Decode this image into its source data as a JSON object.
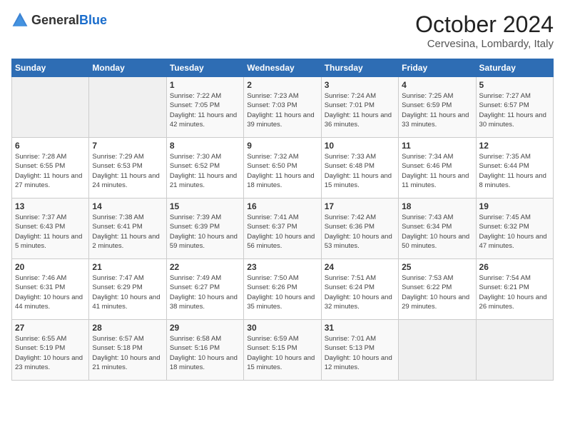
{
  "header": {
    "logo_general": "General",
    "logo_blue": "Blue",
    "month": "October 2024",
    "location": "Cervesina, Lombardy, Italy"
  },
  "days_of_week": [
    "Sunday",
    "Monday",
    "Tuesday",
    "Wednesday",
    "Thursday",
    "Friday",
    "Saturday"
  ],
  "weeks": [
    [
      {
        "day": "",
        "empty": true
      },
      {
        "day": "",
        "empty": true
      },
      {
        "day": "1",
        "sunrise": "Sunrise: 7:22 AM",
        "sunset": "Sunset: 7:05 PM",
        "daylight": "Daylight: 11 hours and 42 minutes."
      },
      {
        "day": "2",
        "sunrise": "Sunrise: 7:23 AM",
        "sunset": "Sunset: 7:03 PM",
        "daylight": "Daylight: 11 hours and 39 minutes."
      },
      {
        "day": "3",
        "sunrise": "Sunrise: 7:24 AM",
        "sunset": "Sunset: 7:01 PM",
        "daylight": "Daylight: 11 hours and 36 minutes."
      },
      {
        "day": "4",
        "sunrise": "Sunrise: 7:25 AM",
        "sunset": "Sunset: 6:59 PM",
        "daylight": "Daylight: 11 hours and 33 minutes."
      },
      {
        "day": "5",
        "sunrise": "Sunrise: 7:27 AM",
        "sunset": "Sunset: 6:57 PM",
        "daylight": "Daylight: 11 hours and 30 minutes."
      }
    ],
    [
      {
        "day": "6",
        "sunrise": "Sunrise: 7:28 AM",
        "sunset": "Sunset: 6:55 PM",
        "daylight": "Daylight: 11 hours and 27 minutes."
      },
      {
        "day": "7",
        "sunrise": "Sunrise: 7:29 AM",
        "sunset": "Sunset: 6:53 PM",
        "daylight": "Daylight: 11 hours and 24 minutes."
      },
      {
        "day": "8",
        "sunrise": "Sunrise: 7:30 AM",
        "sunset": "Sunset: 6:52 PM",
        "daylight": "Daylight: 11 hours and 21 minutes."
      },
      {
        "day": "9",
        "sunrise": "Sunrise: 7:32 AM",
        "sunset": "Sunset: 6:50 PM",
        "daylight": "Daylight: 11 hours and 18 minutes."
      },
      {
        "day": "10",
        "sunrise": "Sunrise: 7:33 AM",
        "sunset": "Sunset: 6:48 PM",
        "daylight": "Daylight: 11 hours and 15 minutes."
      },
      {
        "day": "11",
        "sunrise": "Sunrise: 7:34 AM",
        "sunset": "Sunset: 6:46 PM",
        "daylight": "Daylight: 11 hours and 11 minutes."
      },
      {
        "day": "12",
        "sunrise": "Sunrise: 7:35 AM",
        "sunset": "Sunset: 6:44 PM",
        "daylight": "Daylight: 11 hours and 8 minutes."
      }
    ],
    [
      {
        "day": "13",
        "sunrise": "Sunrise: 7:37 AM",
        "sunset": "Sunset: 6:43 PM",
        "daylight": "Daylight: 11 hours and 5 minutes."
      },
      {
        "day": "14",
        "sunrise": "Sunrise: 7:38 AM",
        "sunset": "Sunset: 6:41 PM",
        "daylight": "Daylight: 11 hours and 2 minutes."
      },
      {
        "day": "15",
        "sunrise": "Sunrise: 7:39 AM",
        "sunset": "Sunset: 6:39 PM",
        "daylight": "Daylight: 10 hours and 59 minutes."
      },
      {
        "day": "16",
        "sunrise": "Sunrise: 7:41 AM",
        "sunset": "Sunset: 6:37 PM",
        "daylight": "Daylight: 10 hours and 56 minutes."
      },
      {
        "day": "17",
        "sunrise": "Sunrise: 7:42 AM",
        "sunset": "Sunset: 6:36 PM",
        "daylight": "Daylight: 10 hours and 53 minutes."
      },
      {
        "day": "18",
        "sunrise": "Sunrise: 7:43 AM",
        "sunset": "Sunset: 6:34 PM",
        "daylight": "Daylight: 10 hours and 50 minutes."
      },
      {
        "day": "19",
        "sunrise": "Sunrise: 7:45 AM",
        "sunset": "Sunset: 6:32 PM",
        "daylight": "Daylight: 10 hours and 47 minutes."
      }
    ],
    [
      {
        "day": "20",
        "sunrise": "Sunrise: 7:46 AM",
        "sunset": "Sunset: 6:31 PM",
        "daylight": "Daylight: 10 hours and 44 minutes."
      },
      {
        "day": "21",
        "sunrise": "Sunrise: 7:47 AM",
        "sunset": "Sunset: 6:29 PM",
        "daylight": "Daylight: 10 hours and 41 minutes."
      },
      {
        "day": "22",
        "sunrise": "Sunrise: 7:49 AM",
        "sunset": "Sunset: 6:27 PM",
        "daylight": "Daylight: 10 hours and 38 minutes."
      },
      {
        "day": "23",
        "sunrise": "Sunrise: 7:50 AM",
        "sunset": "Sunset: 6:26 PM",
        "daylight": "Daylight: 10 hours and 35 minutes."
      },
      {
        "day": "24",
        "sunrise": "Sunrise: 7:51 AM",
        "sunset": "Sunset: 6:24 PM",
        "daylight": "Daylight: 10 hours and 32 minutes."
      },
      {
        "day": "25",
        "sunrise": "Sunrise: 7:53 AM",
        "sunset": "Sunset: 6:22 PM",
        "daylight": "Daylight: 10 hours and 29 minutes."
      },
      {
        "day": "26",
        "sunrise": "Sunrise: 7:54 AM",
        "sunset": "Sunset: 6:21 PM",
        "daylight": "Daylight: 10 hours and 26 minutes."
      }
    ],
    [
      {
        "day": "27",
        "sunrise": "Sunrise: 6:55 AM",
        "sunset": "Sunset: 5:19 PM",
        "daylight": "Daylight: 10 hours and 23 minutes."
      },
      {
        "day": "28",
        "sunrise": "Sunrise: 6:57 AM",
        "sunset": "Sunset: 5:18 PM",
        "daylight": "Daylight: 10 hours and 21 minutes."
      },
      {
        "day": "29",
        "sunrise": "Sunrise: 6:58 AM",
        "sunset": "Sunset: 5:16 PM",
        "daylight": "Daylight: 10 hours and 18 minutes."
      },
      {
        "day": "30",
        "sunrise": "Sunrise: 6:59 AM",
        "sunset": "Sunset: 5:15 PM",
        "daylight": "Daylight: 10 hours and 15 minutes."
      },
      {
        "day": "31",
        "sunrise": "Sunrise: 7:01 AM",
        "sunset": "Sunset: 5:13 PM",
        "daylight": "Daylight: 10 hours and 12 minutes."
      },
      {
        "day": "",
        "empty": true
      },
      {
        "day": "",
        "empty": true
      }
    ]
  ]
}
